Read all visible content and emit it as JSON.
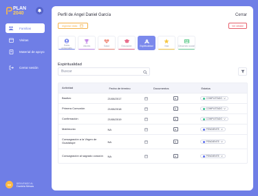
{
  "app": {
    "logo_plan": "PLAN",
    "logo_year": "2040"
  },
  "sidebar": {
    "items": [
      {
        "label": "Familias",
        "icon": "family-icon",
        "active": true
      },
      {
        "label": "Visitas",
        "icon": "visits-icon",
        "active": false
      },
      {
        "label": "Material de apoyo",
        "icon": "book-icon",
        "active": false
      },
      {
        "label": "Cerrar sesión",
        "icon": "logout-icon",
        "active": false
      }
    ],
    "user": {
      "initials": "DM",
      "caption": "BIENVENIDO AL",
      "name": "Daniela Mesas"
    }
  },
  "header": {
    "title": "Perfil de Angel Daniel García",
    "close_label": "Cerrar",
    "register_label": "registrar visita",
    "view_label": "Ver detalle"
  },
  "categories": [
    {
      "label": "Datos personales",
      "color": "#7b89ec",
      "active": false
    },
    {
      "label": "Valores",
      "color": "#c58be8",
      "active": false
    },
    {
      "label": "Salud",
      "color": "#f08a7a",
      "active": false
    },
    {
      "label": "Educación",
      "color": "#e86a8a",
      "active": false
    },
    {
      "label": "Espiritualidad",
      "color": "#7b89ec",
      "active": true
    },
    {
      "label": "Vida",
      "color": "#f6c744",
      "active": false
    },
    {
      "label": "Desarrollo social",
      "color": "#6fcf97",
      "active": false
    }
  ],
  "section": {
    "title": "Espiritualidad",
    "search_placeholder": "Buscar"
  },
  "table": {
    "headers": [
      "Actividad",
      "Fecha de término",
      "Documentos",
      "Estatus"
    ],
    "rows": [
      {
        "activity": "Bautizo",
        "date": "21/08/2017",
        "status": "COMPLETADO",
        "status_color": "#34c38f"
      },
      {
        "activity": "Primera Comunión",
        "date": "21/08/2018",
        "status": "COMPLETADO",
        "status_color": "#34c38f"
      },
      {
        "activity": "Confirmación",
        "date": "21/08/2019",
        "status": "COMPLETADO",
        "status_color": "#34c38f"
      },
      {
        "activity": "Matrimonio",
        "date": "NA",
        "status": "PENDIENTE",
        "status_color": "#5b6df0"
      },
      {
        "activity": "Consagración a la Virgen de Guadalupe",
        "date": "NA",
        "status": "PENDIENTE",
        "status_color": "#5b6df0"
      },
      {
        "activity": "Consagración al sagrado corazón",
        "date": "NA",
        "status": "PENDIENTE",
        "status_color": "#5b6df0"
      }
    ]
  }
}
